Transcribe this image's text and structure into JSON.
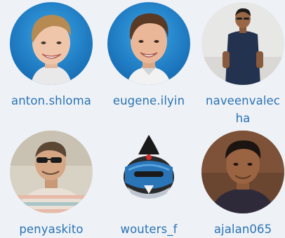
{
  "contributors": [
    {
      "username": "anton.shloma",
      "avatar": "avatar-man-blond-blue-background"
    },
    {
      "username": "eugene.ilyin",
      "avatar": "avatar-man-brown-hair-blue-background"
    },
    {
      "username": "naveenvalecha",
      "avatar": "avatar-man-standing-glasses"
    },
    {
      "username": "penyaskito",
      "avatar": "avatar-man-sunglasses-striped-shirt"
    },
    {
      "username": "wouters_f",
      "avatar": "avatar-drupal-ninja-logo"
    },
    {
      "username": "ajalan065",
      "avatar": "avatar-man-dark-shirt"
    }
  ],
  "colors": {
    "link": "#2a72b3",
    "background": "#eef2f7",
    "avatar_blue": "#1b7fc6"
  }
}
